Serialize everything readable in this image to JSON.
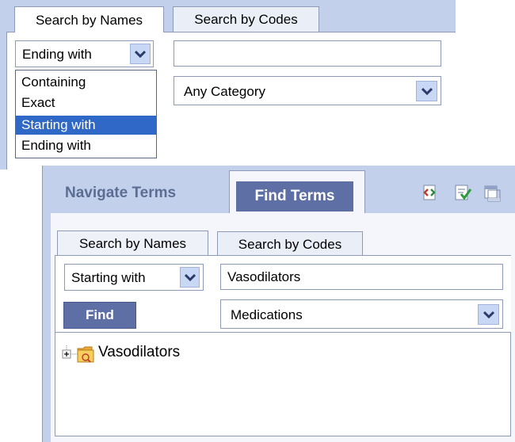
{
  "top_panel": {
    "tabs": [
      {
        "label": "Search by Names",
        "active": true
      },
      {
        "label": "Search by Codes",
        "active": false
      }
    ],
    "match_select": {
      "value": "Ending with"
    },
    "search_input": {
      "value": ""
    },
    "category_select": {
      "value": "Any Category"
    },
    "match_options": [
      {
        "label": "Containing",
        "selected": false
      },
      {
        "label": "Exact",
        "selected": false
      },
      {
        "label": "Starting with",
        "selected": true
      },
      {
        "label": "Ending with",
        "selected": false
      }
    ]
  },
  "bottom_panel": {
    "nav_tabs": [
      {
        "label": "Navigate Terms",
        "active": false
      },
      {
        "label": "Find Terms",
        "active": true
      }
    ],
    "toolbar_icons": [
      "code-view-icon",
      "checklist-icon",
      "window-icon"
    ],
    "tabs": [
      {
        "label": "Search by Names",
        "active": true
      },
      {
        "label": "Search by Codes",
        "active": false
      }
    ],
    "match_select": {
      "value": "Starting with"
    },
    "search_input": {
      "value": "Vasodilators"
    },
    "find_button": {
      "label": "Find"
    },
    "category_select": {
      "value": "Medications"
    },
    "results": [
      {
        "label": "Vasodilators",
        "expander": "+",
        "icon": "folder-icon"
      }
    ]
  },
  "colors": {
    "panel_bg": "#c2d0ec",
    "accent": "#5e6fa6",
    "selection": "#3068c8",
    "border": "#8d9bb8"
  }
}
